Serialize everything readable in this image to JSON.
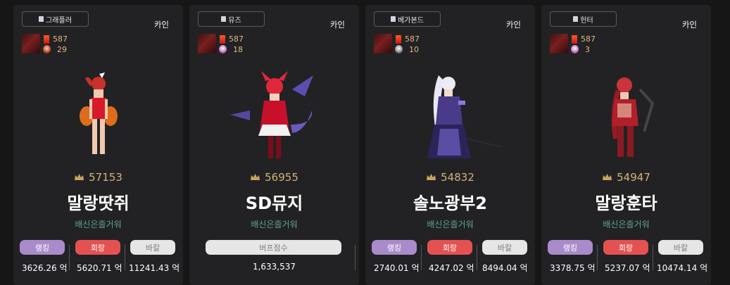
{
  "cards": [
    {
      "job": "그래플러",
      "server": "카인",
      "fame": "587",
      "level": "29",
      "score": "57153",
      "name": "말랑땃쥐",
      "guild": "배신은즐거워",
      "rank_label": "랭킹",
      "rank_val": "3626.26 억",
      "hoe_label": "회랑",
      "hoe_val": "5620.71 억",
      "bak_label": "바칼",
      "bak_val": "11241.43 억"
    },
    {
      "job": "뮤즈",
      "server": "카인",
      "fame": "587",
      "level": "18",
      "score": "56955",
      "name": "SD뮤지",
      "guild": "배신은즐거워",
      "buff_label": "버프점수",
      "buff_val": "1,633,537"
    },
    {
      "job": "베가본드",
      "server": "카인",
      "fame": "587",
      "level": "10",
      "score": "54832",
      "name": "솔노광부2",
      "guild": "배신은즐거워",
      "rank_label": "랭킹",
      "rank_val": "2740.01 억",
      "hoe_label": "회랑",
      "hoe_val": "4247.02 억",
      "bak_label": "바칼",
      "bak_val": "8494.04 억"
    },
    {
      "job": "헌터",
      "server": "카인",
      "fame": "587",
      "level": "3",
      "score": "54947",
      "name": "말랑훈타",
      "guild": "배신은즐거워",
      "rank_label": "랭킹",
      "rank_val": "3378.75 억",
      "hoe_label": "회랑",
      "hoe_val": "5237.07 억",
      "bak_label": "바칼",
      "bak_val": "10474.14 억"
    }
  ],
  "colors": {
    "rank": "#a98bc9",
    "hoe": "#e55151",
    "bak": "#e6e6e6",
    "guild": "#5fa58a",
    "score": "#d4b27a"
  },
  "icons": {
    "job": "character-icon",
    "fame": "fame-icon",
    "level": "level-icon",
    "score": "crown-icon"
  }
}
